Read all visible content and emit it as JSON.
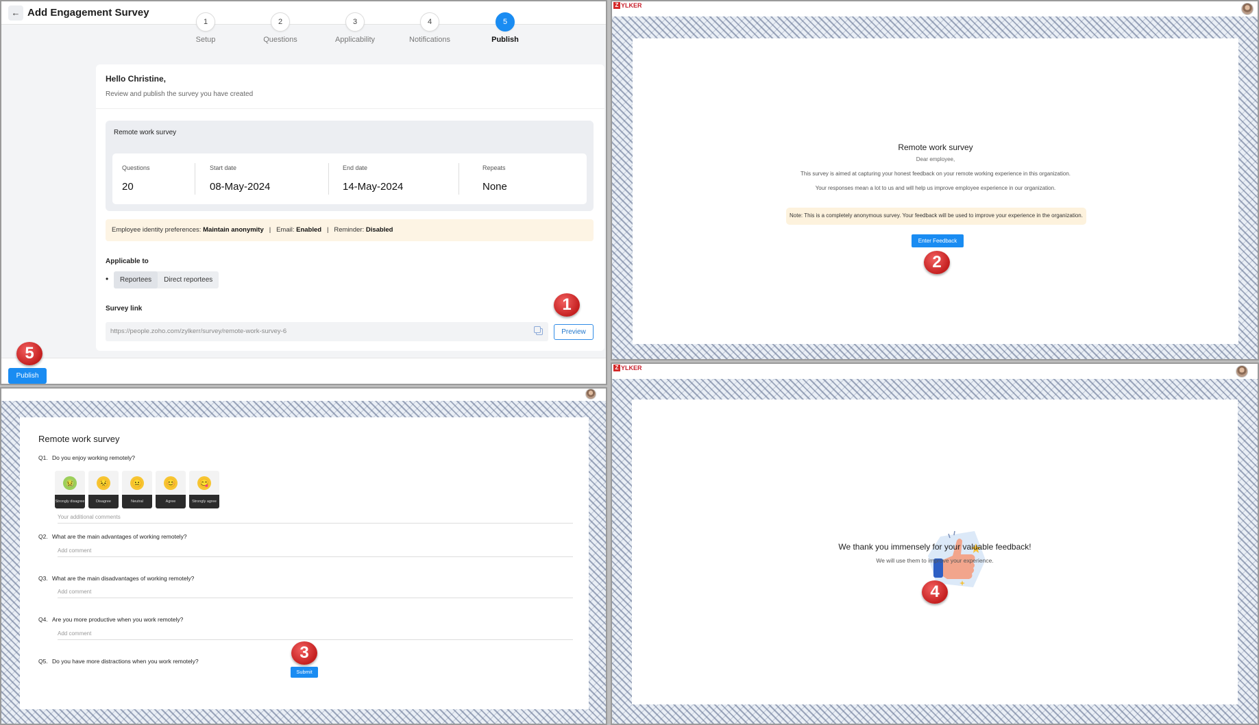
{
  "setup": {
    "title": "Add Engagement Survey",
    "steps": [
      {
        "num": "1",
        "label": "Setup"
      },
      {
        "num": "2",
        "label": "Questions"
      },
      {
        "num": "3",
        "label": "Applicability"
      },
      {
        "num": "4",
        "label": "Notifications"
      },
      {
        "num": "5",
        "label": "Publish"
      }
    ],
    "greeting": "Hello Christine,",
    "greeting_sub": "Review and publish the survey you have created",
    "survey_name": "Remote work survey",
    "stats": [
      {
        "label": "Questions",
        "value": "20"
      },
      {
        "label": "Start date",
        "value": "08-May-2024"
      },
      {
        "label": "End date",
        "value": "14-May-2024"
      },
      {
        "label": "Repeats",
        "value": "None"
      }
    ],
    "prefs": {
      "identity_label": "Employee identity preferences:",
      "identity_value": "Maintain anonymity",
      "sep": "|",
      "email_label": "Email:",
      "email_value": "Enabled",
      "reminder_label": "Reminder:",
      "reminder_value": "Disabled"
    },
    "applicable_label": "Applicable to",
    "applicable_chips": [
      "Reportees",
      "Direct reportees"
    ],
    "link_label": "Survey link",
    "link_value": "https://people.zoho.com/zylkerr/survey/remote-work-survey-6",
    "preview_label": "Preview",
    "publish_label": "Publish"
  },
  "markers": {
    "m1": "1",
    "m2": "2",
    "m3": "3",
    "m4": "4",
    "m5": "5"
  },
  "brand": {
    "logo_z": "Z",
    "logo_text": "YLKER"
  },
  "intro": {
    "title": "Remote work survey",
    "salutation": "Dear employee,",
    "line1": "This survey is aimed at capturing your honest feedback on your remote working experience in this organization.",
    "line2": "Your responses mean a lot to us and will help us improve employee experience in our organization.",
    "note": "Note: This is a completely anonymous survey. Your feedback will be used to improve your experience in the organization.",
    "button": "Enter Feedback"
  },
  "form": {
    "title": "Remote work survey",
    "questions": [
      {
        "num": "Q1.",
        "text": "Do you enjoy working remotely?",
        "placeholder": "Your additional comments"
      },
      {
        "num": "Q2.",
        "text": "What are the main advantages of working remotely?",
        "placeholder": "Add comment"
      },
      {
        "num": "Q3.",
        "text": "What are the main disadvantages of working remotely?",
        "placeholder": "Add comment"
      },
      {
        "num": "Q4.",
        "text": "Are you more productive when you work remotely?",
        "placeholder": "Add comment"
      },
      {
        "num": "Q5.",
        "text": "Do you have more distractions when you work remotely?"
      }
    ],
    "ratings": [
      {
        "label": "Strongly disagree",
        "emoji": "🤢",
        "icon": "nauseated-face-icon"
      },
      {
        "label": "Disagree",
        "emoji": "😣",
        "icon": "persevering-face-icon"
      },
      {
        "label": "Neutral",
        "emoji": "😐",
        "icon": "neutral-face-icon"
      },
      {
        "label": "Agree",
        "emoji": "😊",
        "icon": "smiling-face-icon"
      },
      {
        "label": "Strongly agree",
        "emoji": "😋",
        "icon": "grinning-face-icon"
      }
    ],
    "submit": "Submit"
  },
  "thanks": {
    "title": "We thank you immensely for your valuable feedback!",
    "sub": "We will use them to improve your experience."
  },
  "colors": {
    "primary": "#1a8cf2",
    "marker": "#c41f1f",
    "note_bg": "#fdf2dd"
  }
}
